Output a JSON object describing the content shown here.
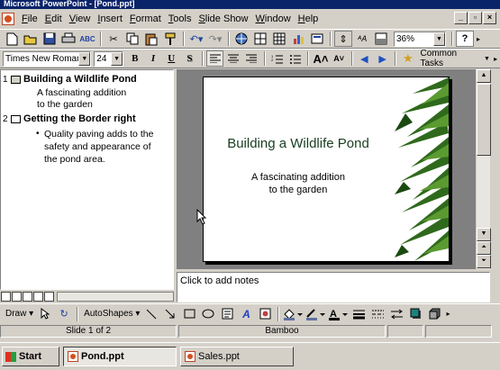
{
  "window": {
    "title": "Microsoft PowerPoint - [Pond.ppt]"
  },
  "menu": [
    "File",
    "Edit",
    "View",
    "Insert",
    "Format",
    "Tools",
    "Slide Show",
    "Window",
    "Help"
  ],
  "toolbar": {
    "zoom": "36%",
    "help": "?"
  },
  "format_toolbar": {
    "font": "Times New Roman",
    "size": "24",
    "bold": "B",
    "italic": "I",
    "underline": "U",
    "shadow": "S",
    "common_tasks": "Common Tasks"
  },
  "outline": {
    "slides": [
      {
        "num": "1",
        "title": "Building a Wildlife Pond",
        "body": [
          "A fascinating addition",
          "to the garden"
        ]
      },
      {
        "num": "2",
        "title": "Getting the Border right",
        "bullets": [
          "Quality paving adds to the",
          "safety and appearance of",
          "the pond area."
        ]
      }
    ],
    "bullet_glyph": "•"
  },
  "slide": {
    "title": "Building a Wildlife Pond",
    "subtitle_lines": [
      "A fascinating addition",
      "to the garden"
    ]
  },
  "notes": {
    "placeholder": "Click to add notes"
  },
  "draw_toolbar": {
    "draw": "Draw",
    "autoshapes": "AutoShapes"
  },
  "status": {
    "slide": "Slide 1 of 2",
    "design": "Bamboo"
  },
  "taskbar": {
    "start": "Start",
    "tasks": [
      "Pond.ppt",
      "Sales.ppt"
    ]
  }
}
